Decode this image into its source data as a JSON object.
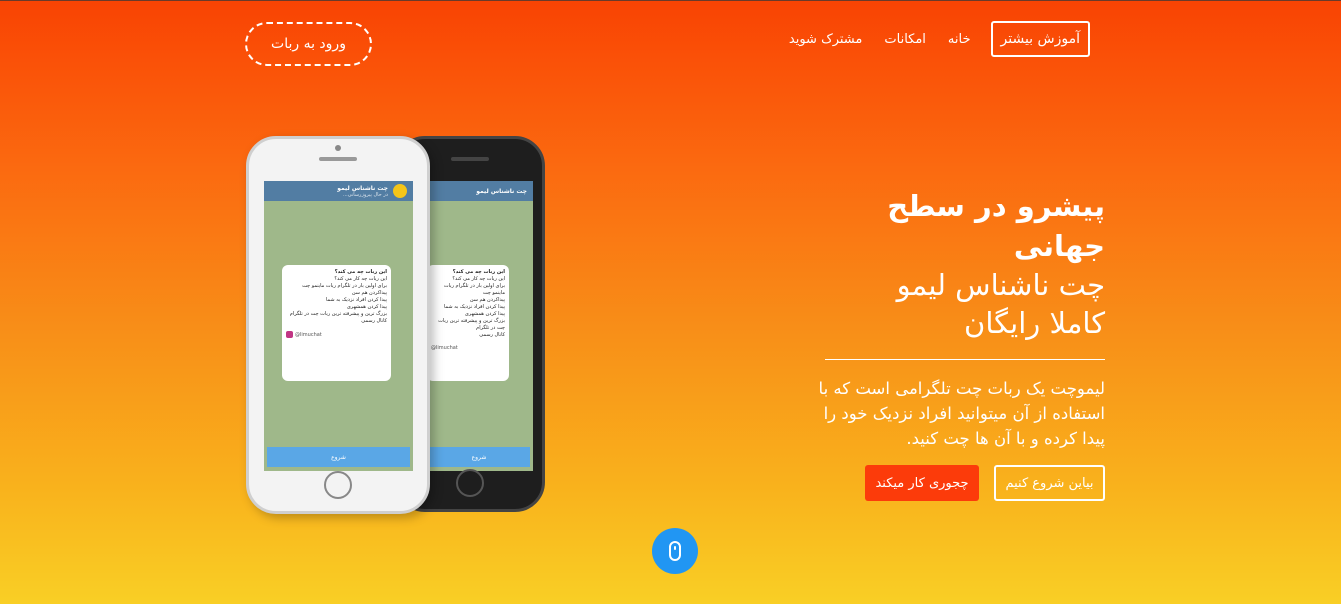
{
  "nav": {
    "learn_more": "آموزش بیشتر",
    "home": "خانه",
    "features": "امکانات",
    "subscribe": "مشترک شوید",
    "login_bot": "ورود به ربات"
  },
  "hero": {
    "title": "پیشرو در سطح جهانی",
    "subtitle_line1": "چت ناشناس لیمو",
    "subtitle_line2": "کاملا رایگان",
    "description": "لیموچت یک ربات چت تلگرامی است که با استفاده از آن میتوانید افراد نزدیک خود را پیدا کرده و با آن ها چت کنید.",
    "cta_start": "بیاین شروع کنیم",
    "cta_how": "چجوری کار میکند"
  },
  "phone_screen": {
    "chat_title": "چت ناشناس لیمو",
    "chat_status": "در حال پیروزرسانی...",
    "bubble_heading": "این ربات چه می کند؟",
    "bubble_q": "این ربات چه کار می کند؟",
    "bubble_intro": "برای اولین بار در تلگرام ربات ماینمو چت",
    "bubble_items": [
      "پیداکردن هم سن",
      "پیدا کردن افراد نزدیک به شما",
      "پیدا کردن همشهری",
      "بزرگ ترین و پیشرفته ترین ربات چت در تلگرام"
    ],
    "bubble_channel": "کانال رسمی",
    "bubble_handle": "@limuchat",
    "start_button": "شروع"
  },
  "colors": {
    "accent_orange": "#fc3b0a",
    "scroll_blue": "#2196f3"
  },
  "icons": {
    "scroll": "mouse-icon"
  }
}
